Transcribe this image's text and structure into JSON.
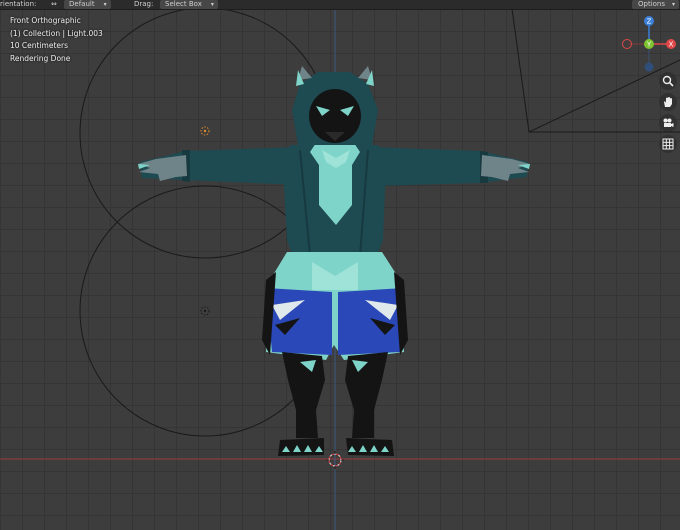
{
  "header": {
    "orientation_label": "rientation:",
    "orientation_value": "Default",
    "drag_label": "Drag:",
    "drag_value": "Select Box",
    "options_label": "Options"
  },
  "viewport_info": {
    "view_name": "Front Orthographic",
    "collection": "(1) Collection | Light.003",
    "scale": "10 Centimeters",
    "status": "Rendering Done"
  },
  "gizmo": {
    "axes": [
      "Z",
      "X",
      "Y"
    ],
    "colors": {
      "x": "#e04848",
      "y": "#7ec430",
      "z": "#3b7fd8"
    }
  },
  "nav_buttons": [
    "zoom-icon",
    "pan-hand-icon",
    "camera-icon",
    "grid-icon"
  ],
  "colors": {
    "hoodie": "#1e4a52",
    "body": "#7fd4c9",
    "shorts": "#2a48b8",
    "dark": "#141414",
    "axis_red": "#9a3a3a"
  }
}
